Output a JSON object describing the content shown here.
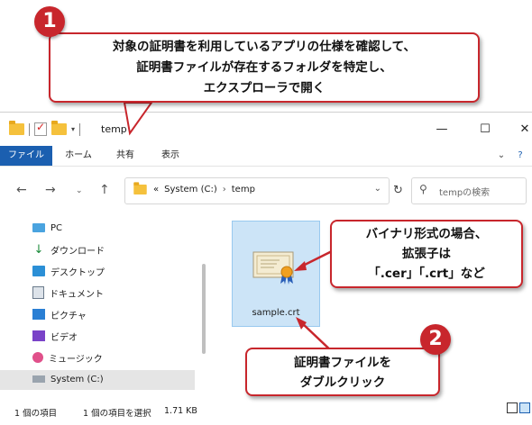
{
  "window": {
    "title": "temp",
    "ribbon_tabs": [
      "ファイル",
      "ホーム",
      "共有",
      "表示"
    ],
    "minimize_glyph": "—",
    "maximize_glyph": "☐",
    "close_glyph": "✕",
    "collapse_glyph": "⌄",
    "help_glyph": "?"
  },
  "address": {
    "prefix": "«",
    "crumb1": "System (C:)",
    "crumb2": "temp",
    "search_placeholder": "tempの検索"
  },
  "sidebar": {
    "items": [
      {
        "label": "PC",
        "icon": "pc-icon"
      },
      {
        "label": "ダウンロード",
        "icon": "download-icon"
      },
      {
        "label": "デスクトップ",
        "icon": "desktop-icon"
      },
      {
        "label": "ドキュメント",
        "icon": "documents-icon"
      },
      {
        "label": "ピクチャ",
        "icon": "pictures-icon"
      },
      {
        "label": "ビデオ",
        "icon": "videos-icon"
      },
      {
        "label": "ミュージック",
        "icon": "music-icon"
      },
      {
        "label": "System (C:)",
        "icon": "drive-icon"
      }
    ]
  },
  "file": {
    "name": "sample.crt",
    "icon": "certificate-icon"
  },
  "status": {
    "count": "1 個の項目",
    "selection": "1 個の項目を選択",
    "size": "1.71 KB"
  },
  "callouts": {
    "step1_num": "1",
    "step1_line1": "対象の証明書を利用しているアプリの仕様を確認して、",
    "step1_line2": "証明書ファイルが存在するフォルダを特定し、",
    "step1_line3": "エクスプローラで開く",
    "ext_line1": "バイナリ形式の場合、",
    "ext_line2": "拡張子は",
    "ext_line3": "「.cer」「.crt」など",
    "step2_num": "2",
    "step2_line1": "証明書ファイルを",
    "step2_line2": "ダブルクリック"
  },
  "colors": {
    "accent_red": "#c8262c",
    "ribbon_blue": "#1b5fb0",
    "selection_blue": "#cce4f7"
  }
}
